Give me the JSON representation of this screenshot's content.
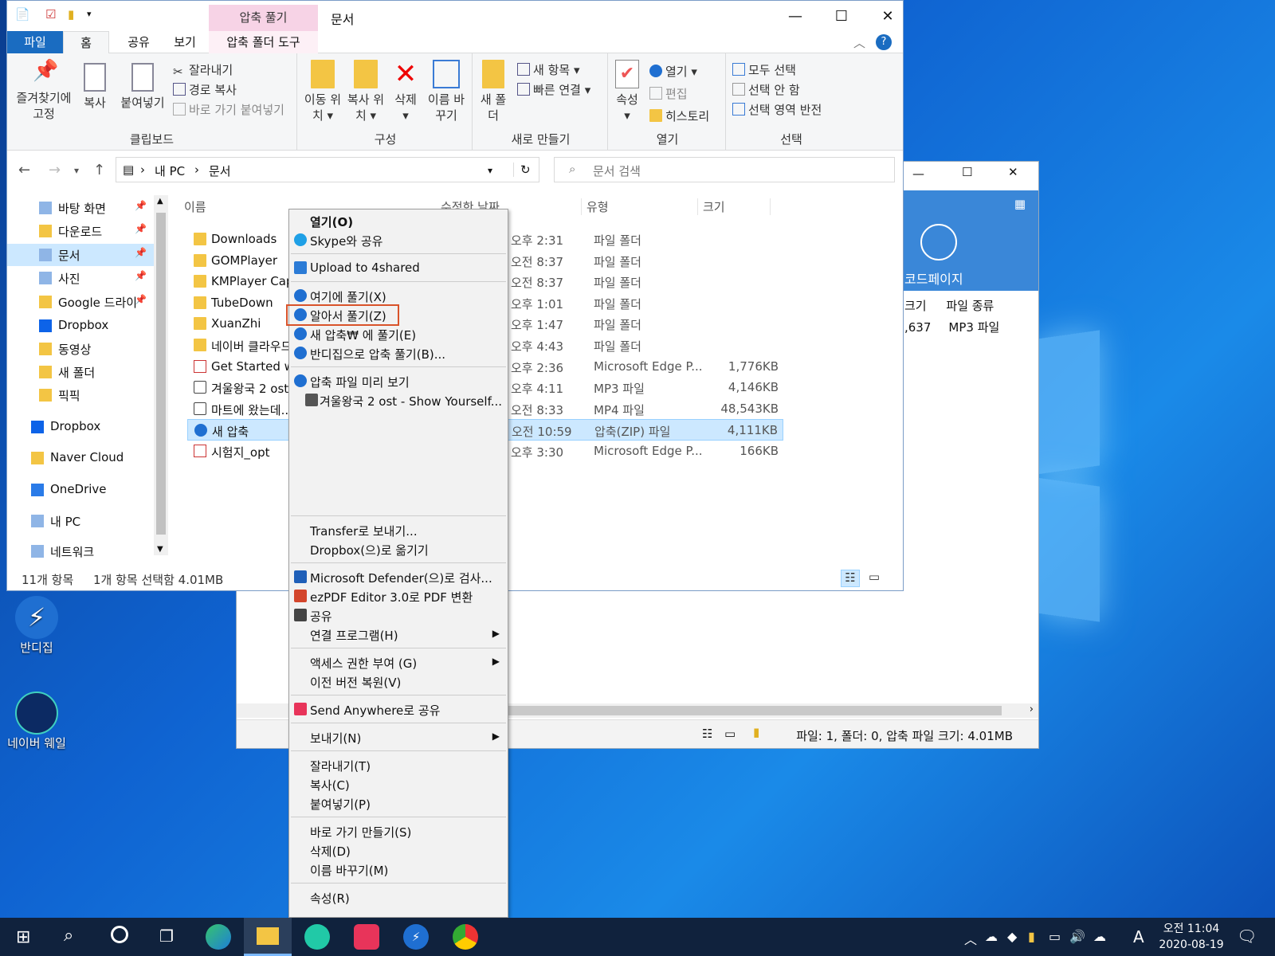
{
  "explorer": {
    "title": "문서",
    "context_tab": "압축 풀기",
    "tabs": [
      "파일",
      "홈",
      "공유",
      "보기",
      "압축 폴더 도구"
    ],
    "ribbon": {
      "clipboard": {
        "label": "클립보드",
        "pin": "즐겨찾기에 고정",
        "copy": "복사",
        "paste": "붙여넣기",
        "cut": "잘라내기",
        "copy_path": "경로 복사",
        "paste_shortcut": "바로 가기 붙여넣기"
      },
      "organize": {
        "label": "구성",
        "move": "이동 위치",
        "copy_to": "복사 위치",
        "delete": "삭제",
        "rename": "이름 바꾸기"
      },
      "new": {
        "label": "새로 만들기",
        "new_folder": "새 폴더",
        "new_item": "새 항목",
        "easy_access": "빠른 연결"
      },
      "open": {
        "label": "열기",
        "properties": "속성",
        "open": "열기",
        "edit": "편집",
        "history": "히스토리"
      },
      "select": {
        "label": "선택",
        "all": "모두 선택",
        "none": "선택 안 함",
        "invert": "선택 영역 반전"
      }
    },
    "breadcrumb": [
      "내 PC",
      "문서"
    ],
    "search_placeholder": "문서 검색",
    "columns": {
      "name": "이름",
      "date": "수정한 날짜",
      "type": "유형",
      "size": "크기"
    },
    "nav": [
      {
        "label": "바탕 화면",
        "pinned": true
      },
      {
        "label": "다운로드",
        "pinned": true
      },
      {
        "label": "문서",
        "pinned": true,
        "selected": true
      },
      {
        "label": "사진",
        "pinned": true
      },
      {
        "label": "Google 드라이",
        "pinned": true
      },
      {
        "label": "Dropbox"
      },
      {
        "label": "동영상"
      },
      {
        "label": "새 폴더"
      },
      {
        "label": "픽픽"
      },
      {
        "label": "Dropbox"
      },
      {
        "label": "Naver Cloud"
      },
      {
        "label": "OneDrive"
      },
      {
        "label": "내 PC"
      },
      {
        "label": "네트워크"
      }
    ],
    "files": [
      {
        "name": "Downloads",
        "date": "오후 2:31",
        "type": "파일 폴더",
        "size": "",
        "kind": "folder"
      },
      {
        "name": "GOMPlayer",
        "date": "오전 8:37",
        "type": "파일 폴더",
        "size": "",
        "kind": "folder"
      },
      {
        "name": "KMPlayer Capt",
        "date": "오전 8:37",
        "type": "파일 폴더",
        "size": "",
        "kind": "folder"
      },
      {
        "name": "TubeDown",
        "date": "오후 1:01",
        "type": "파일 폴더",
        "size": "",
        "kind": "folder"
      },
      {
        "name": "XuanZhi",
        "date": "오후 1:47",
        "type": "파일 폴더",
        "size": "",
        "kind": "folder"
      },
      {
        "name": "네이버 클라우드",
        "date": "오후 4:43",
        "type": "파일 폴더",
        "size": "",
        "kind": "folder"
      },
      {
        "name": "Get Started wit",
        "date": "오후 2:36",
        "type": "Microsoft Edge P...",
        "size": "1,776KB",
        "kind": "pdf"
      },
      {
        "name": "겨울왕국 2 ost",
        "date": "오후 4:11",
        "type": "MP3 파일",
        "size": "4,146KB",
        "kind": "media"
      },
      {
        "name": "마트에 왔는데...",
        "date": "오전 8:33",
        "type": "MP4 파일",
        "size": "48,543KB",
        "kind": "media"
      },
      {
        "name": "새 압축",
        "date": "오전 10:59",
        "type": "압축(ZIP) 파일",
        "size": "4,111KB",
        "kind": "zip",
        "selected": true
      },
      {
        "name": "시험지_opt",
        "date": "오후 3:30",
        "type": "Microsoft Edge P...",
        "size": "166KB",
        "kind": "pdf"
      }
    ],
    "status": {
      "count": "11개 항목",
      "selection": "1개 항목 선택함 4.01MB"
    }
  },
  "context_menu": {
    "items": [
      {
        "label": "열기(O)",
        "bold": true
      },
      {
        "label": "Skype와 공유",
        "icon": "skype-icon"
      },
      {
        "sep": true
      },
      {
        "label": "Upload to 4shared",
        "icon": "4shared-icon"
      },
      {
        "sep": true
      },
      {
        "label": "여기에 풀기(X)",
        "icon": "bandizip-icon"
      },
      {
        "label": "알아서 풀기(Z)",
        "icon": "bandizip-icon",
        "highlight": true
      },
      {
        "label": "새 압축₩ 에 풀기(E)",
        "icon": "bandizip-icon"
      },
      {
        "label": "반디집으로 압축 풀기(B)...",
        "icon": "bandizip-icon"
      },
      {
        "sep": true
      },
      {
        "label": "압축 파일 미리 보기",
        "icon": "bandizip-icon"
      },
      {
        "label": "겨울왕국 2 ost - Show Yourself...",
        "icon": "media-icon",
        "indent": true
      },
      {
        "spacer": true
      },
      {
        "sep": true
      },
      {
        "label": "Transfer로 보내기..."
      },
      {
        "label": "Dropbox(으)로 옮기기"
      },
      {
        "sep": true
      },
      {
        "label": "Microsoft Defender(으)로 검사...",
        "icon": "defender-icon"
      },
      {
        "label": "ezPDF Editor 3.0로 PDF 변환",
        "icon": "ezpdf-icon"
      },
      {
        "label": "공유",
        "icon": "share-icon"
      },
      {
        "label": "연결 프로그램(H)",
        "submenu": true
      },
      {
        "sep": true
      },
      {
        "label": "액세스 권한 부여 (G)",
        "submenu": true
      },
      {
        "label": "이전 버전 복원(V)"
      },
      {
        "sep": true
      },
      {
        "label": "Send Anywhere로 공유",
        "icon": "sendanywhere-icon"
      },
      {
        "sep": true
      },
      {
        "label": "보내기(N)",
        "submenu": true
      },
      {
        "sep": true
      },
      {
        "label": "잘라내기(T)"
      },
      {
        "label": "복사(C)"
      },
      {
        "label": "붙여넣기(P)"
      },
      {
        "sep": true
      },
      {
        "label": "바로 가기 만들기(S)"
      },
      {
        "label": "삭제(D)"
      },
      {
        "label": "이름 바꾸기(M)"
      },
      {
        "sep": true
      },
      {
        "label": "속성(R)"
      }
    ]
  },
  "bandizip_window": {
    "codepage": "코드페이지",
    "col_size": "크기",
    "col_type": "파일 종류",
    "row_size": ",637",
    "row_type": "MP3 파일",
    "status": "파일: 1, 폴더: 0, 압축 파일 크기: 4.01MB"
  },
  "desktop": {
    "icons": [
      "반디집",
      "네이버 웨일"
    ]
  },
  "taskbar": {
    "time": "오전 11:04",
    "date": "2020-08-19",
    "ime": "A"
  },
  "colors": {
    "accent": "#1a6cc1",
    "selection": "#cce8ff",
    "highlight_border": "#d9532a",
    "taskbar": "#10223d"
  }
}
